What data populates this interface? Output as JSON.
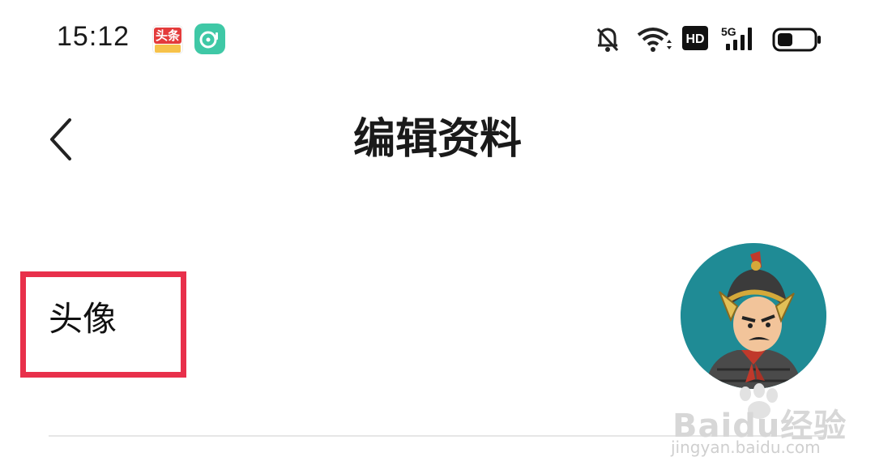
{
  "status_bar": {
    "time": "15:12",
    "apps": [
      {
        "icon": "toutiao-app-icon",
        "label": "头条"
      },
      {
        "icon": "music-app-icon"
      }
    ],
    "indicators": [
      "bell-muted-icon",
      "wifi-icon",
      "hd-icon",
      "5g-signal-icon",
      "battery-icon"
    ],
    "hd_label": "HD",
    "network_label": "5G"
  },
  "header": {
    "back_icon": "chevron-left-icon",
    "title": "编辑资料"
  },
  "profile": {
    "avatar_label": "头像",
    "avatar_icon": "cartoon-warrior-avatar",
    "highlight_color": "#e8304b",
    "avatar_bg_color": "#1f8b95"
  },
  "watermark": {
    "brand": "Baidu经验",
    "url": "jingyan.baidu.com"
  }
}
